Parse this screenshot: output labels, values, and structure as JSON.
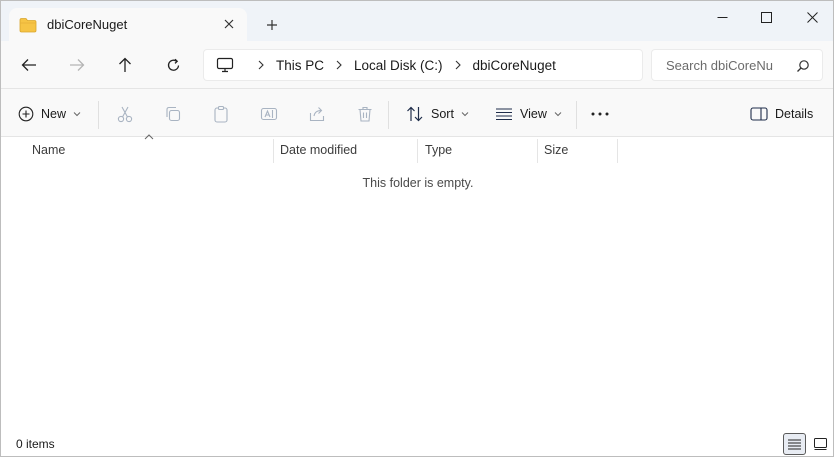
{
  "tab": {
    "title": "dbiCoreNuget"
  },
  "breadcrumb": {
    "items": [
      "This PC",
      "Local Disk (C:)",
      "dbiCoreNuget"
    ]
  },
  "search": {
    "placeholder": "Search dbiCoreNu"
  },
  "commands": {
    "new": "New",
    "sort": "Sort",
    "view": "View",
    "details": "Details"
  },
  "columns": [
    "Name",
    "Date modified",
    "Type",
    "Size"
  ],
  "content": {
    "empty_message": "This folder is empty."
  },
  "status": {
    "item_count": "0 items"
  },
  "colors": {
    "folder": "#f6c445",
    "accent": "#0067c0"
  }
}
